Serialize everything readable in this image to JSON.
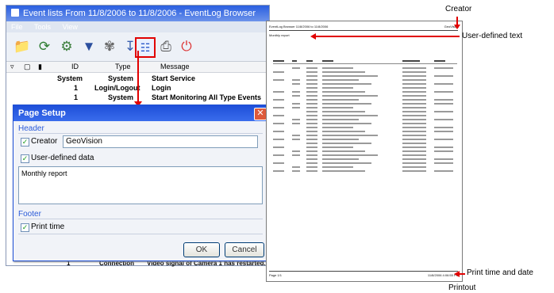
{
  "window": {
    "title": "Event lists From 11/8/2006 to 11/8/2006 - EventLog Browser",
    "menu": [
      "File",
      "Tools",
      "View"
    ],
    "toolbar_icons": [
      "folder-icon",
      "refresh-icon",
      "connect-icon",
      "filter-icon",
      "query-icon",
      "export-icon",
      "page-setup-icon",
      "print-icon",
      "power-icon"
    ],
    "columns": [
      "ID",
      "Type",
      "Message"
    ],
    "rows": [
      {
        "id": "System",
        "type": "System",
        "message": "Start Service"
      },
      {
        "id": "1",
        "type": "Login/Logout",
        "message": "Login"
      },
      {
        "id": "1",
        "type": "System",
        "message": "Start Monitoring All Type Events"
      }
    ],
    "partial_row": {
      "id": "1",
      "type": "Connection",
      "message": "Video signal of Camera 1 has restarted."
    }
  },
  "dialog": {
    "title": "Page Setup",
    "header_group": "Header",
    "creator_label": "Creator",
    "creator_value": "GeoVision",
    "creator_checked": true,
    "user_defined_label": "User-defined data",
    "user_defined_checked": true,
    "user_defined_value": "Monthly report",
    "footer_group": "Footer",
    "print_time_label": "Print time",
    "print_time_checked": true,
    "ok_label": "OK",
    "cancel_label": "Cancel"
  },
  "printout": {
    "header_left": "EventLog Browser 11/8/2006 to 11/8/2006",
    "header_right": "GeoVision",
    "user_text": "Monthly report",
    "footer_left": "Page 1/1",
    "footer_right": "11/8/2006 4:06:55 PM",
    "caption": "Printout"
  },
  "annotations": {
    "creator": "Creator",
    "user_defined_text": "User-defined text",
    "print_time": "Print time and date"
  },
  "colors": {
    "accent_red": "#e10000",
    "titlebar_blue": "#2a5fe0"
  }
}
